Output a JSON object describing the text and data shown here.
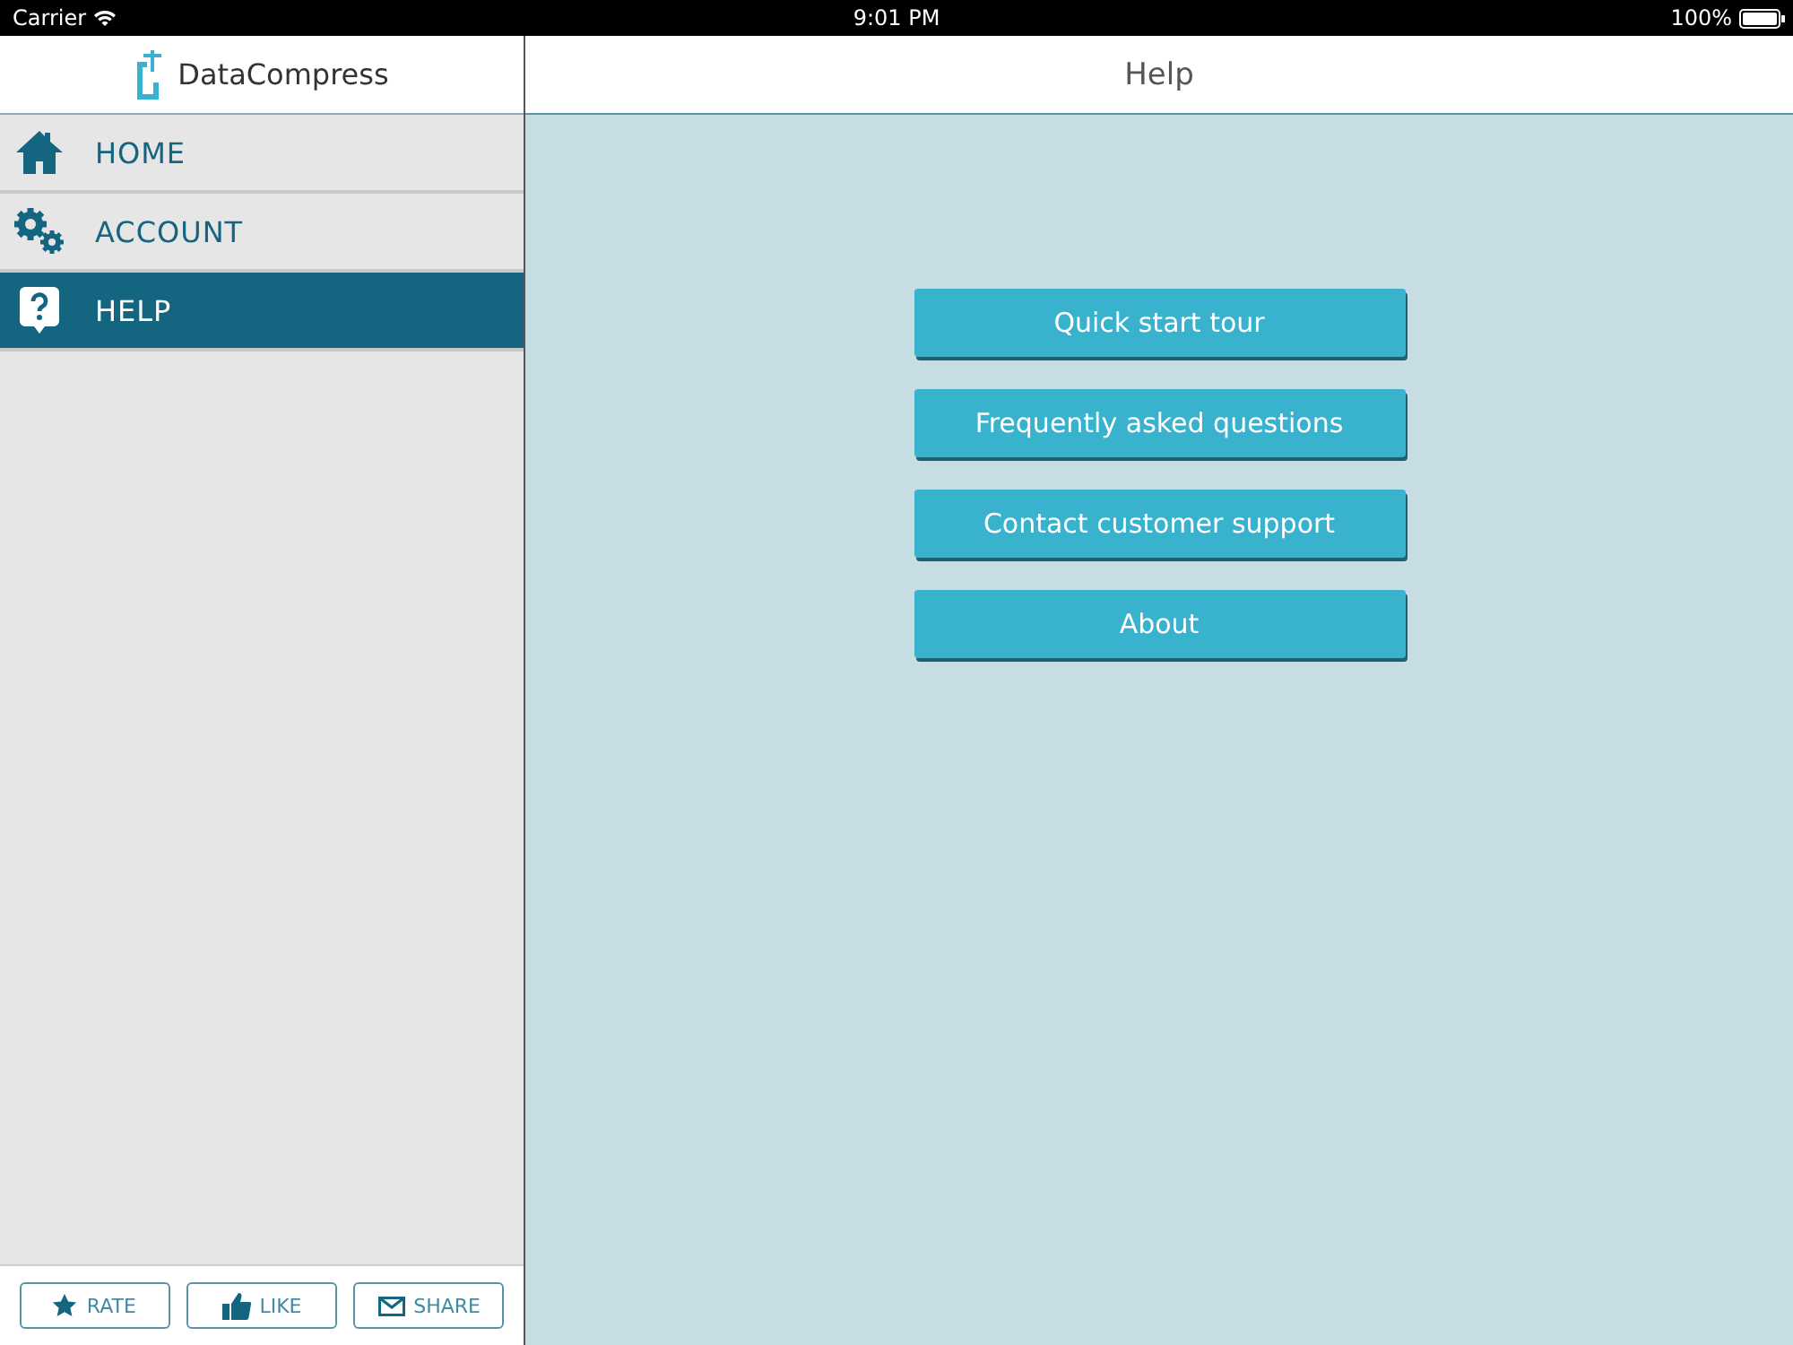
{
  "status_bar": {
    "carrier": "Carrier",
    "time": "9:01 PM",
    "battery": "100%"
  },
  "sidebar": {
    "logo": "DataCompress",
    "items": [
      {
        "kind": "home",
        "label": "HOME",
        "selected": false
      },
      {
        "kind": "account",
        "label": "ACCOUNT",
        "selected": false
      },
      {
        "kind": "help",
        "label": "HELP",
        "selected": true
      }
    ],
    "footer_buttons": [
      {
        "kind": "rate",
        "label": "RATE"
      },
      {
        "kind": "like",
        "label": "LIKE"
      },
      {
        "kind": "share",
        "label": "SHARE"
      }
    ]
  },
  "header": {
    "title": "Help"
  },
  "buttons": [
    "Quick start tour",
    "Frequently asked questions",
    "Contact customer support",
    "About"
  ]
}
